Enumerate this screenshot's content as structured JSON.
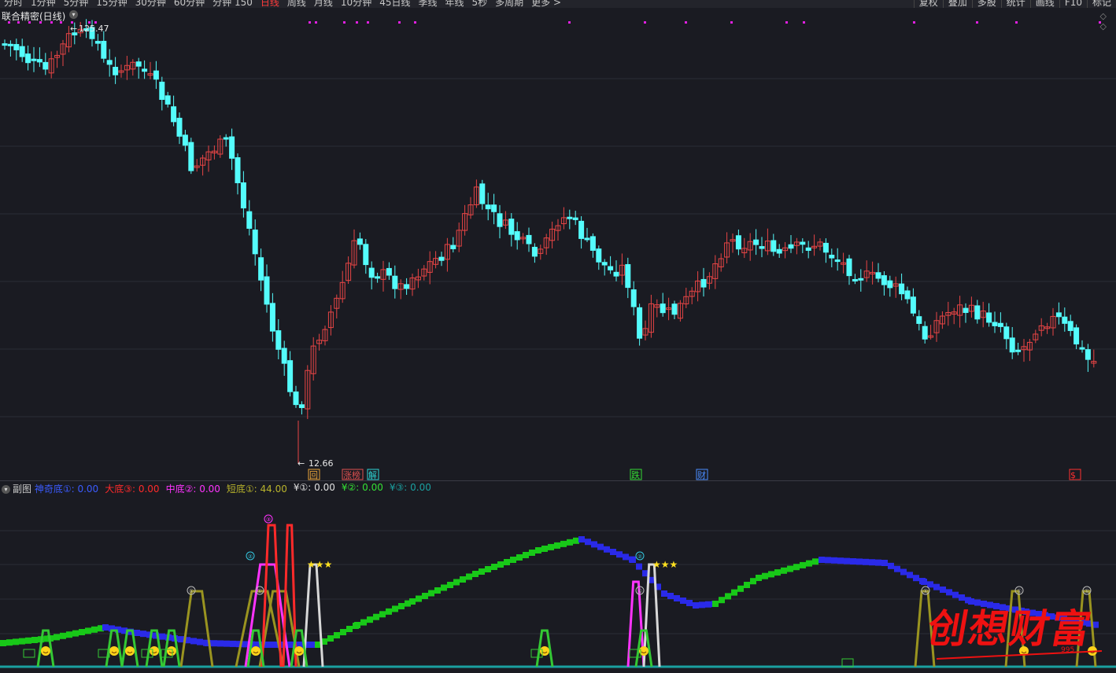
{
  "toolbar": {
    "periods": [
      "分时",
      "1分钟",
      "5分钟",
      "15分钟",
      "30分钟",
      "60分钟",
      "分钟 150",
      "日线",
      "周线",
      "月线",
      "10分钟",
      "45日线",
      "季线",
      "年线",
      "5秒",
      "多周期",
      "更多 >"
    ],
    "active_period": "日线",
    "tools": [
      "复权",
      "叠加",
      "多股",
      "统计",
      "画线",
      "F10",
      "标记"
    ]
  },
  "main_panel": {
    "title": "联合精密(日线)",
    "high_label": "125.47",
    "low_label": "12.66",
    "markers": [
      {
        "text": "回",
        "color": "#e8a33a"
      },
      {
        "text": "涨榜",
        "color": "#e05050"
      },
      {
        "text": "解",
        "color": "#2ed6d6"
      },
      {
        "text": "跌",
        "color": "#34d834"
      },
      {
        "text": "财",
        "color": "#4a8cff"
      },
      {
        "text": "$",
        "color": "#ff3030"
      }
    ],
    "up_color": "#e84545",
    "down_color": "#54fcfc"
  },
  "sub_panel": {
    "title": "副图",
    "indicators": [
      {
        "label": "神奇底①:",
        "value": "0.00",
        "color": "#3b5bff"
      },
      {
        "label": "大底③:",
        "value": "0.00",
        "color": "#ff2a2a"
      },
      {
        "label": "中底②:",
        "value": "0.00",
        "color": "#ff33ff"
      },
      {
        "label": "短底①:",
        "value": "44.00",
        "color": "#b8b32c"
      },
      {
        "label": "¥①:",
        "value": "0.00",
        "color": "#e0e0e0"
      },
      {
        "label": "¥②:",
        "value": "0.00",
        "color": "#34e034"
      },
      {
        "label": "¥③:",
        "value": "0.00",
        "color": "#1aa0a0"
      }
    ],
    "stars": "★★★",
    "circle_labels": [
      "①",
      "②",
      "③"
    ]
  },
  "watermark": {
    "text": "创想财富",
    "sub": "995"
  }
}
